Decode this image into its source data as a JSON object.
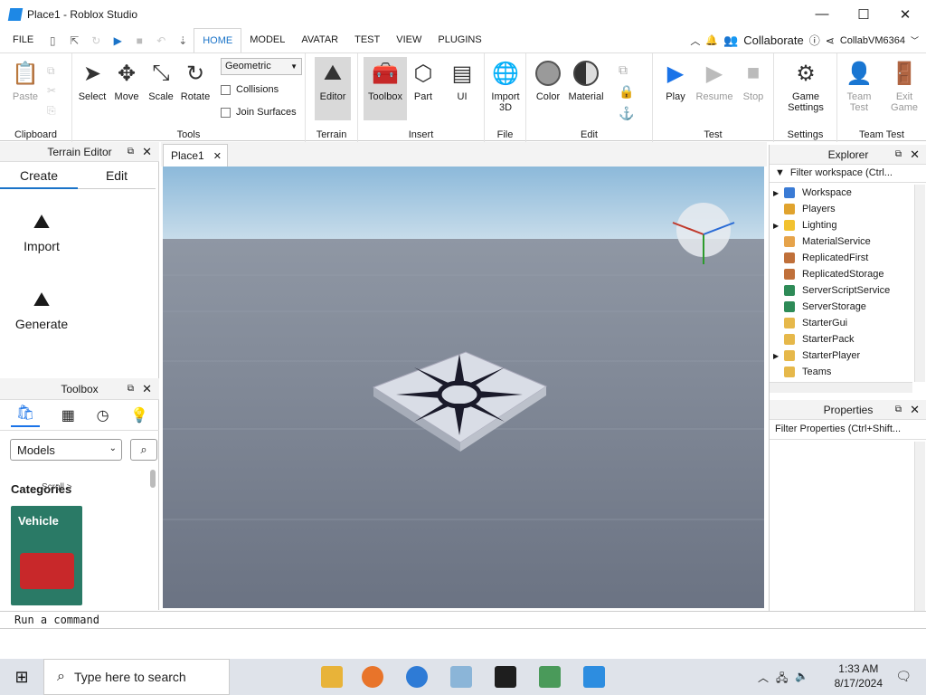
{
  "window": {
    "title": "Place1 - Roblox Studio",
    "minimize": "—",
    "maximize": "☐",
    "close": "✕"
  },
  "menu": {
    "file": "FILE",
    "tabs": [
      "HOME",
      "MODEL",
      "AVATAR",
      "TEST",
      "VIEW",
      "PLUGINS"
    ],
    "collaborate": "Collaborate",
    "user": "CollabVM6364"
  },
  "ribbon": {
    "clipboard": {
      "label": "Clipboard",
      "paste": "Paste"
    },
    "tools": {
      "label": "Tools",
      "select": "Select",
      "move": "Move",
      "scale": "Scale",
      "rotate": "Rotate",
      "mode_value": "Geometric",
      "collisions": "Collisions",
      "join_surfaces": "Join Surfaces"
    },
    "terrain": {
      "label": "Terrain",
      "editor": "Editor"
    },
    "insert": {
      "label": "Insert",
      "toolbox": "Toolbox",
      "part": "Part",
      "ui": "UI"
    },
    "file": {
      "label": "File",
      "import3d": "Import 3D"
    },
    "edit": {
      "label": "Edit",
      "color": "Color",
      "material": "Material"
    },
    "test": {
      "label": "Test",
      "play": "Play",
      "resume": "Resume",
      "stop": "Stop"
    },
    "settings": {
      "label": "Settings",
      "game_settings": "Game Settings"
    },
    "team_test": {
      "label": "Team Test",
      "team_test": "Team Test",
      "exit_game": "Exit Game"
    }
  },
  "terrain_editor": {
    "title": "Terrain Editor",
    "tabs": [
      "Create",
      "Edit"
    ],
    "import": "Import",
    "generate": "Generate"
  },
  "toolbox": {
    "title": "Toolbox",
    "dropdown_value": "Models",
    "categories": "Categories",
    "scroll_hint": "Scroll >",
    "card": "Vehicle"
  },
  "doc_tab": {
    "label": "Place1"
  },
  "explorer": {
    "title": "Explorer",
    "filter_placeholder": "Filter workspace (Ctrl...",
    "items": [
      {
        "label": "Workspace",
        "expandable": true,
        "color": "#3a7bd5"
      },
      {
        "label": "Players",
        "expandable": false,
        "color": "#e0a32e"
      },
      {
        "label": "Lighting",
        "expandable": true,
        "color": "#f2c230"
      },
      {
        "label": "MaterialService",
        "expandable": false,
        "color": "#e6a34a"
      },
      {
        "label": "ReplicatedFirst",
        "expandable": false,
        "color": "#c0703a"
      },
      {
        "label": "ReplicatedStorage",
        "expandable": false,
        "color": "#c0703a"
      },
      {
        "label": "ServerScriptService",
        "expandable": false,
        "color": "#2e8b57"
      },
      {
        "label": "ServerStorage",
        "expandable": false,
        "color": "#2e8b57"
      },
      {
        "label": "StarterGui",
        "expandable": false,
        "color": "#e6b84a"
      },
      {
        "label": "StarterPack",
        "expandable": false,
        "color": "#e6b84a"
      },
      {
        "label": "StarterPlayer",
        "expandable": true,
        "color": "#e6b84a"
      },
      {
        "label": "Teams",
        "expandable": false,
        "color": "#e6b84a"
      }
    ]
  },
  "properties": {
    "title": "Properties",
    "filter_placeholder": "Filter Properties (Ctrl+Shift..."
  },
  "command": {
    "placeholder": "Run a command"
  },
  "taskbar": {
    "search": "Type here to search",
    "time": "1:33 AM",
    "date": "8/17/2024"
  }
}
